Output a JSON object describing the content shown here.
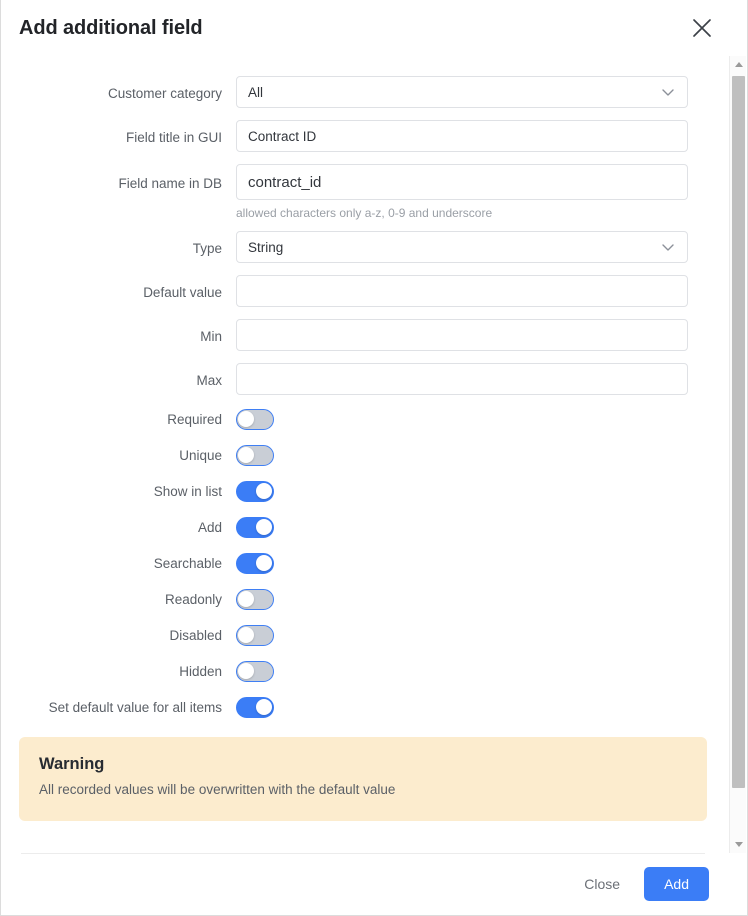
{
  "dialog": {
    "title": "Add additional field",
    "close_icon": "close-icon"
  },
  "form": {
    "customer_category": {
      "label": "Customer category",
      "value": "All",
      "icon": "chevron-down-icon"
    },
    "field_title_gui": {
      "label": "Field title in GUI",
      "value": "Contract ID",
      "placeholder": ""
    },
    "field_name_db": {
      "label": "Field name in DB",
      "value": "contract_id",
      "placeholder": "",
      "helper": "allowed characters only a-z, 0-9 and underscore"
    },
    "type": {
      "label": "Type",
      "value": "String",
      "icon": "chevron-down-icon"
    },
    "default_value": {
      "label": "Default value",
      "value": "",
      "placeholder": ""
    },
    "min": {
      "label": "Min",
      "value": "",
      "placeholder": ""
    },
    "max": {
      "label": "Max",
      "value": "",
      "placeholder": ""
    }
  },
  "toggles": [
    {
      "label": "Required",
      "state": "off"
    },
    {
      "label": "Unique",
      "state": "off"
    },
    {
      "label": "Show in list",
      "state": "on"
    },
    {
      "label": "Add",
      "state": "on"
    },
    {
      "label": "Searchable",
      "state": "on"
    },
    {
      "label": "Readonly",
      "state": "off"
    },
    {
      "label": "Disabled",
      "state": "off"
    },
    {
      "label": "Hidden",
      "state": "off"
    },
    {
      "label": "Set default value for all items",
      "state": "on"
    }
  ],
  "warning": {
    "title": "Warning",
    "text": "All recorded values will be overwritten with the default value"
  },
  "footer": {
    "close_label": "Close",
    "add_label": "Add"
  },
  "colors": {
    "accent": "#3b7df6",
    "toggle_off_track": "#c9ced6",
    "warning_bg": "#fcecce",
    "input_border": "#dfe1e5",
    "label_text": "#5b6067"
  }
}
